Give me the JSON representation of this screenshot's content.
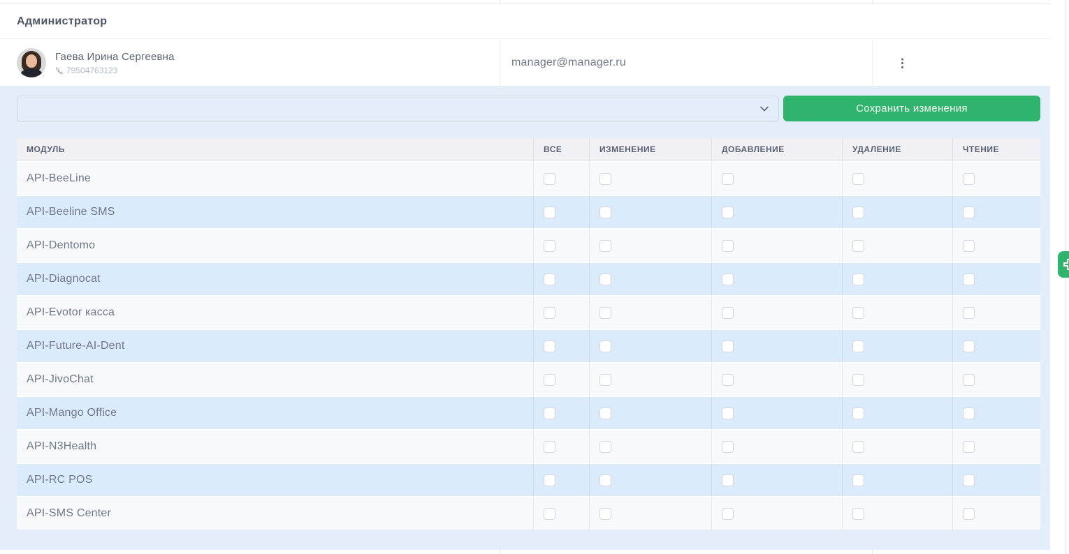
{
  "section": {
    "title": "Администратор"
  },
  "user": {
    "name": "Гаева Ирина Сергеевна",
    "phone": "79504763123",
    "email": "manager@manager.ru"
  },
  "toolbar": {
    "role_select_value": "",
    "save_button_label": "Сохранить изменения"
  },
  "table": {
    "headers": [
      "МОДУЛЬ",
      "ВСЕ",
      "ИЗМЕНЕНИЕ",
      "ДОБАВЛЕНИЕ",
      "УДАЛЕНИЕ",
      "ЧТЕНИЕ"
    ],
    "rows": [
      {
        "module": "API-BeeLine",
        "permissions": [
          false,
          false,
          false,
          false,
          false
        ]
      },
      {
        "module": "API-Beeline SMS",
        "permissions": [
          false,
          false,
          false,
          false,
          false
        ]
      },
      {
        "module": "API-Dentomo",
        "permissions": [
          false,
          false,
          false,
          false,
          false
        ]
      },
      {
        "module": "API-Diagnocat",
        "permissions": [
          false,
          false,
          false,
          false,
          false
        ]
      },
      {
        "module": "API-Evotor касса",
        "permissions": [
          false,
          false,
          false,
          false,
          false
        ]
      },
      {
        "module": "API-Future-AI-Dent",
        "permissions": [
          false,
          false,
          false,
          false,
          false
        ]
      },
      {
        "module": "API-JivoChat",
        "permissions": [
          false,
          false,
          false,
          false,
          false
        ]
      },
      {
        "module": "API-Mango Office",
        "permissions": [
          false,
          false,
          false,
          false,
          false
        ]
      },
      {
        "module": "API-N3Health",
        "permissions": [
          false,
          false,
          false,
          false,
          false
        ]
      },
      {
        "module": "API-RC POS",
        "permissions": [
          false,
          false,
          false,
          false,
          false
        ]
      },
      {
        "module": "API-SMS Center",
        "permissions": [
          false,
          false,
          false,
          false,
          false
        ]
      }
    ]
  },
  "icons": {
    "phone_icon": "phone-receiver",
    "kebab_icon": "⋮",
    "chevron_down_icon": "chevron-down",
    "edge_tab_icon": "plus"
  },
  "colors": {
    "accent_green": "#2fb46e",
    "section_bg_blue": "#e4eefb",
    "row_stripe_blue": "#dcebfc",
    "row_stripe_light": "#f8f9fb",
    "table_header_bg": "#f0f0f5",
    "text_primary": "#4b5563",
    "text_secondary": "#6e7887",
    "text_muted": "#b2bac6"
  }
}
